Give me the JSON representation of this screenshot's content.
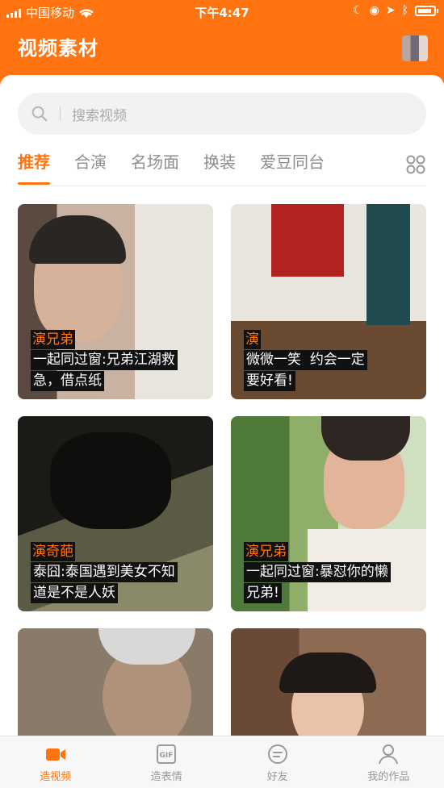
{
  "status_bar": {
    "carrier": "中国移动",
    "time": "下午4:47"
  },
  "header": {
    "title": "视频素材"
  },
  "search": {
    "placeholder": "搜索视频"
  },
  "tabs": [
    {
      "label": "推荐",
      "active": true
    },
    {
      "label": "合演",
      "active": false
    },
    {
      "label": "名场面",
      "active": false
    },
    {
      "label": "换装",
      "active": false
    },
    {
      "label": "爱豆同台",
      "active": false
    }
  ],
  "cards": [
    {
      "tag": "演兄弟",
      "lines": [
        "一起同过窗:兄弟江湖救",
        "急，借点纸"
      ]
    },
    {
      "tag": "演",
      "lines": [
        "微微一笑",
        "约会一定",
        "要好看!"
      ]
    },
    {
      "tag": "演奇葩",
      "lines": [
        "泰囧:泰国遇到美女不知",
        "道是不是人妖"
      ]
    },
    {
      "tag": "演兄弟",
      "lines": [
        "一起同过窗:暴怼你的懒",
        "兄弟!"
      ]
    },
    {
      "tag": "",
      "lines": []
    },
    {
      "tag": "",
      "lines": []
    }
  ],
  "bottom_nav": [
    {
      "label": "造视频",
      "icon": "video-camera-icon",
      "active": true
    },
    {
      "label": "造表情",
      "icon": "gif-icon",
      "active": false
    },
    {
      "label": "好友",
      "icon": "chat-icon",
      "active": false
    },
    {
      "label": "我的作品",
      "icon": "person-icon",
      "active": false
    }
  ],
  "colors": {
    "accent": "#ff7410"
  }
}
